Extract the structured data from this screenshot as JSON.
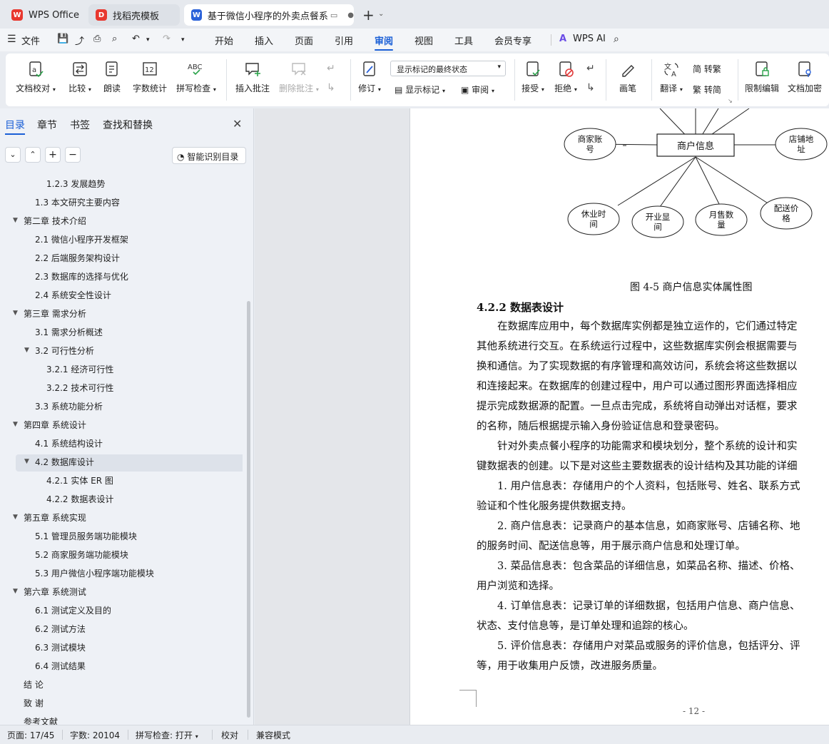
{
  "tabs": [
    {
      "label": "WPS Office"
    },
    {
      "label": "找稻壳模板"
    },
    {
      "label": "基于微信小程序的外卖点餐系统"
    }
  ],
  "menu": {
    "file": "文件",
    "items": [
      "开始",
      "插入",
      "页面",
      "引用",
      "审阅",
      "视图",
      "工具",
      "会员专享"
    ],
    "active": "审阅",
    "wps_ai": "WPS AI"
  },
  "ribbon": {
    "doc_proof": "文档校对",
    "compare": "比较",
    "read_aloud": "朗读",
    "word_count": "字数统计",
    "spell_check": "拼写检查",
    "insert_comment": "插入批注",
    "delete_comment": "删除批注",
    "track_changes": "修订",
    "display_state": "显示标记的最终状态",
    "show_markup": "显示标记",
    "review": "审阅",
    "accept": "接受",
    "reject": "拒绝",
    "pen": "画笔",
    "translate": "翻译",
    "to_traditional": "转繁",
    "to_simplified": "转简",
    "restrict_edit": "限制编辑",
    "encrypt": "文档加密"
  },
  "panel": {
    "tabs": [
      "目录",
      "章节",
      "书签",
      "查找和替换"
    ],
    "active_tab": "目录",
    "smart_toc": "智能识别目录",
    "toc": [
      {
        "label": "1.2.3 发展趋势",
        "level": 3,
        "expanded": null
      },
      {
        "label": "1.3 本文研究主要内容",
        "level": 2,
        "expanded": null
      },
      {
        "label": "第二章 技术介绍",
        "level": 1,
        "expanded": true
      },
      {
        "label": "2.1 微信小程序开发框架",
        "level": 2,
        "expanded": null
      },
      {
        "label": "2.2 后端服务架构设计",
        "level": 2,
        "expanded": null
      },
      {
        "label": "2.3 数据库的选择与优化",
        "level": 2,
        "expanded": null
      },
      {
        "label": "2.4 系统安全性设计",
        "level": 2,
        "expanded": null
      },
      {
        "label": "第三章 需求分析",
        "level": 1,
        "expanded": true
      },
      {
        "label": "3.1 需求分析概述",
        "level": 2,
        "expanded": null
      },
      {
        "label": "3.2 可行性分析",
        "level": 2,
        "expanded": true
      },
      {
        "label": "3.2.1 经济可行性",
        "level": 3,
        "expanded": null
      },
      {
        "label": "3.2.2 技术可行性",
        "level": 3,
        "expanded": null
      },
      {
        "label": "3.3 系统功能分析",
        "level": 2,
        "expanded": null
      },
      {
        "label": "第四章 系统设计",
        "level": 1,
        "expanded": true
      },
      {
        "label": "4.1 系统结构设计",
        "level": 2,
        "expanded": null
      },
      {
        "label": "4.2 数据库设计",
        "level": 2,
        "expanded": true,
        "selected": true
      },
      {
        "label": "4.2.1 实体 ER 图",
        "level": 3,
        "expanded": null
      },
      {
        "label": "4.2.2 数据表设计",
        "level": 3,
        "expanded": null
      },
      {
        "label": "第五章 系统实现",
        "level": 1,
        "expanded": true
      },
      {
        "label": "5.1 管理员服务端功能模块",
        "level": 2,
        "expanded": null
      },
      {
        "label": "5.2 商家服务端功能模块",
        "level": 2,
        "expanded": null
      },
      {
        "label": "5.3 用户微信小程序端功能模块",
        "level": 2,
        "expanded": null
      },
      {
        "label": "第六章 系统测试",
        "level": 1,
        "expanded": true
      },
      {
        "label": "6.1 测试定义及目的",
        "level": 2,
        "expanded": null
      },
      {
        "label": "6.2 测试方法",
        "level": 2,
        "expanded": null
      },
      {
        "label": "6.3 测试模块",
        "level": 2,
        "expanded": null
      },
      {
        "label": "6.4 测试结果",
        "level": 2,
        "expanded": null
      },
      {
        "label": "结 论",
        "level": 1,
        "expanded": null
      },
      {
        "label": "致 谢",
        "level": 1,
        "expanded": null
      },
      {
        "label": "参考文献",
        "level": 1,
        "expanded": null
      }
    ]
  },
  "diagram": {
    "center": "商户信息",
    "attributes": [
      "商家账号",
      "店铺地址",
      "休业时间",
      "开业显间",
      "月售数量",
      "配送价格"
    ]
  },
  "document": {
    "figure_caption": "图 4-5 商户信息实体属性图",
    "section_title": "4.2.2  数据表设计",
    "lines": [
      "　　在数据库应用中，每个数据库实例都是独立运作的，它们通过特定",
      "其他系统进行交互。在系统运行过程中，这些数据库实例会根据需要与",
      "换和通信。为了实现数据的有序管理和高效访问，系统会将这些数据以",
      "和连接起来。在数据库的创建过程中，用户可以通过图形界面选择相应",
      "提示完成数据源的配置。一旦点击完成，系统将自动弹出对话框，要求",
      "的名称，随后根据提示输入身份验证信息和登录密码。",
      "　　针对外卖点餐小程序的功能需求和模块划分，整个系统的设计和实",
      "键数据表的创建。以下是对这些主要数据表的设计结构及其功能的详细",
      "　　1. 用户信息表：存储用户的个人资料，包括账号、姓名、联系方式",
      "验证和个性化服务提供数据支持。",
      "　　2. 商户信息表：记录商户的基本信息，如商家账号、店铺名称、地",
      "的服务时间、配送信息等，用于展示商户信息和处理订单。",
      "　　3. 菜品信息表：包含菜品的详细信息，如菜品名称、描述、价格、",
      "用户浏览和选择。",
      "　　4. 订单信息表：记录订单的详细数据，包括用户信息、商户信息、",
      "状态、支付信息等，是订单处理和追踪的核心。",
      "　　5. 评价信息表：存储用户对菜品或服务的评价信息，包括评分、评",
      "等，用于收集用户反馈，改进服务质量。"
    ],
    "page_number": "- 12 -"
  },
  "status": {
    "page": "页面: 17/45",
    "words": "字数: 20104",
    "spell": "拼写检查: 打开",
    "proof": "校对",
    "compat": "兼容模式"
  }
}
